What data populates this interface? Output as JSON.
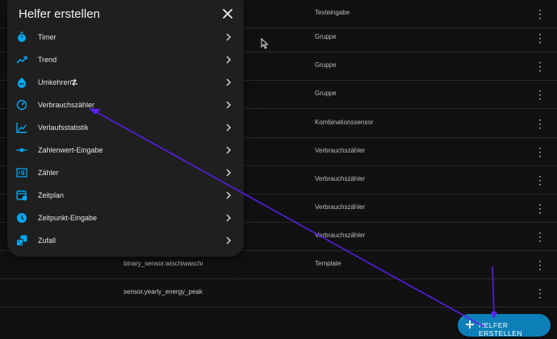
{
  "table": {
    "rows": [
      {
        "entity": "",
        "type": "Texteingabe"
      },
      {
        "entity": "",
        "type": "Gruppe"
      },
      {
        "entity": "",
        "type": "Gruppe"
      },
      {
        "entity": "",
        "type": "Gruppe"
      },
      {
        "entity": "",
        "type": "Kombinationssensor"
      },
      {
        "entity": "",
        "type": "Verbrauchszähler"
      },
      {
        "entity": "",
        "type": "Verbrauchszähler"
      },
      {
        "entity": "",
        "type": "Verbrauchszähler"
      },
      {
        "entity": "",
        "type": "Verbrauchszähler"
      },
      {
        "entity": "binary_sensor.wischiwaschi",
        "type": "Template"
      },
      {
        "entity": "sensor.yearly_energy_peak",
        "type": ""
      }
    ],
    "row_menu_glyph": "⋮"
  },
  "dialog": {
    "title": "Helfer erstellen",
    "items": [
      {
        "label": "Timer",
        "icon": "timer-icon"
      },
      {
        "label": "Trend",
        "icon": "trend-icon"
      },
      {
        "label": "Umkehren",
        "icon": "invert-icon"
      },
      {
        "label": "Verbrauchszähler",
        "icon": "utility-meter-icon"
      },
      {
        "label": "Verlaufsstatistik",
        "icon": "history-stats-icon"
      },
      {
        "label": "Zahlenwert-Eingabe",
        "icon": "number-input-icon"
      },
      {
        "label": "Zähler",
        "icon": "counter-icon"
      },
      {
        "label": "Zeitplan",
        "icon": "schedule-icon"
      },
      {
        "label": "Zeitpunkt-Eingabe",
        "icon": "datetime-input-icon"
      },
      {
        "label": "Zufall",
        "icon": "random-icon"
      }
    ]
  },
  "fab": {
    "label": "HELFER ERSTELLEN"
  },
  "colors": {
    "accent": "#03a9f4",
    "fab": "#0d7fb8",
    "annotation": "#5b1ff0"
  }
}
